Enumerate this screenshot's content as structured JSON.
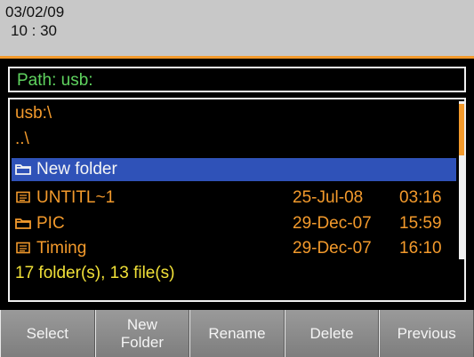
{
  "status": {
    "date": "03/02/09",
    "time": "10 : 30"
  },
  "path": {
    "label": "Path:  usb:"
  },
  "browser": {
    "current_dir": "usb:\\",
    "parent_dir": "..\\",
    "entries": [
      {
        "name": "New folder",
        "type": "folder",
        "date": "",
        "time": "",
        "selected": true
      },
      {
        "name": "UNTITL~1",
        "type": "file",
        "date": "25-Jul-08",
        "time": "03:16",
        "selected": false
      },
      {
        "name": "PIC",
        "type": "folder",
        "date": "29-Dec-07",
        "time": "15:59",
        "selected": false
      },
      {
        "name": "Timing",
        "type": "file",
        "date": "29-Dec-07",
        "time": "16:10",
        "selected": false
      }
    ],
    "summary": "17 folder(s), 13 file(s)"
  },
  "softkeys": [
    {
      "label": "Select"
    },
    {
      "label": "New\nFolder"
    },
    {
      "label": "Rename"
    },
    {
      "label": "Delete"
    },
    {
      "label": "Previous"
    }
  ],
  "colors": {
    "accent": "#f39a2c",
    "selection": "#2f52b8",
    "path_text": "#5fd35f",
    "summary_text": "#f0e038"
  }
}
